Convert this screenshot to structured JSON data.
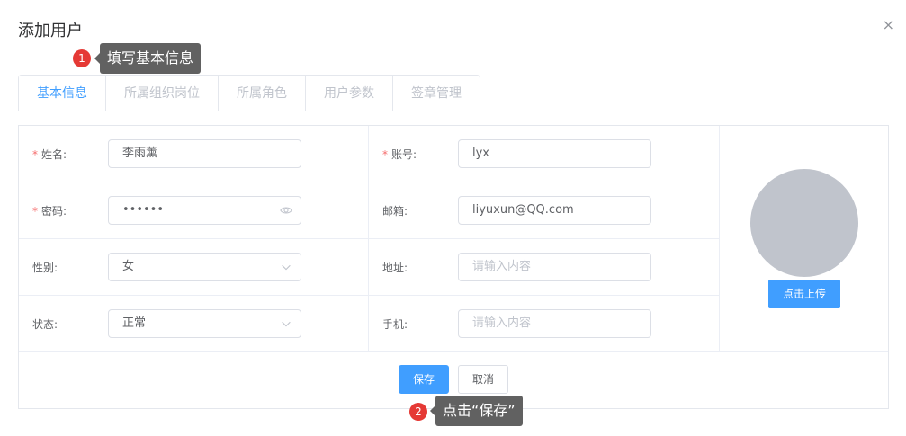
{
  "dialog": {
    "title": "添加用户",
    "close_label": "×"
  },
  "tips": [
    {
      "number": "1",
      "text": "填写基本信息"
    },
    {
      "number": "2",
      "text": "点击“保存”"
    }
  ],
  "tabs": [
    {
      "label": "基本信息",
      "active": true
    },
    {
      "label": "所属组织岗位",
      "active": false
    },
    {
      "label": "所属角色",
      "active": false
    },
    {
      "label": "用户参数",
      "active": false
    },
    {
      "label": "签章管理",
      "active": false
    }
  ],
  "form": {
    "name": {
      "label": "姓名:",
      "required_mark": "*",
      "value": "李雨薰"
    },
    "account": {
      "label": "账号:",
      "required_mark": "*",
      "value": "lyx"
    },
    "password": {
      "label": "密码:",
      "required_mark": "*",
      "value": "••••••"
    },
    "email": {
      "label": "邮箱:",
      "value": "liyuxun@QQ.com"
    },
    "gender": {
      "label": "性别:",
      "value": "女"
    },
    "address": {
      "label": "地址:",
      "placeholder": "请输入内容"
    },
    "status": {
      "label": "状态:",
      "value": "正常"
    },
    "phone": {
      "label": "手机:",
      "placeholder": "请输入内容"
    }
  },
  "upload": {
    "button_label": "点击上传"
  },
  "actions": {
    "save_label": "保存",
    "cancel_label": "取消"
  },
  "colors": {
    "primary": "#409eff",
    "badge": "#e53935",
    "tip_bg": "#616161",
    "avatar": "#c0c4cc"
  }
}
